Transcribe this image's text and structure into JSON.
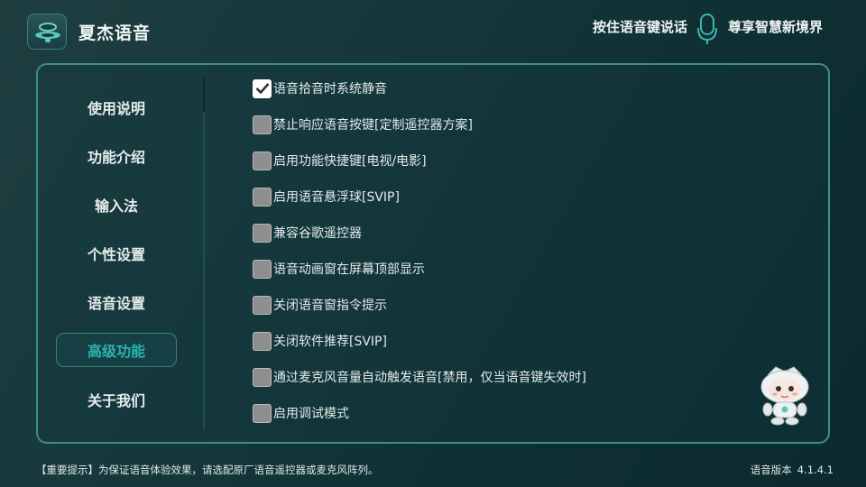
{
  "app": {
    "title": "夏杰语音",
    "logo_icon": "headset-logo-icon"
  },
  "header": {
    "hint": "按住语音键说话",
    "mic_icon": "microphone-icon",
    "slogan": "尊享智慧新境界"
  },
  "sidebar": {
    "items": [
      {
        "label": "使用说明",
        "active": false
      },
      {
        "label": "功能介绍",
        "active": false
      },
      {
        "label": "输入法",
        "active": false
      },
      {
        "label": "个性设置",
        "active": false
      },
      {
        "label": "语音设置",
        "active": false
      },
      {
        "label": "高级功能",
        "active": true
      },
      {
        "label": "关于我们",
        "active": false
      }
    ]
  },
  "options": [
    {
      "label": "语音拾音时系统静音",
      "checked": true
    },
    {
      "label": "禁止响应语音按键[定制遥控器方案]",
      "checked": false
    },
    {
      "label": "启用功能快捷键[电视/电影]",
      "checked": false
    },
    {
      "label": "启用语音悬浮球[SVIP]",
      "checked": false
    },
    {
      "label": "兼容谷歌遥控器",
      "checked": false
    },
    {
      "label": "语音动画窗在屏幕顶部显示",
      "checked": false
    },
    {
      "label": "关闭语音窗指令提示",
      "checked": false
    },
    {
      "label": "关闭软件推荐[SVIP]",
      "checked": false
    },
    {
      "label": "通过麦克风音量自动触发语音[禁用，仅当语音键失效时]",
      "checked": false
    },
    {
      "label": "启用调试模式",
      "checked": false
    }
  ],
  "mascot_icon": "robot-mascot-icon",
  "footer": {
    "notice": "【重要提示】为保证语音体验效果，请选配原厂语音遥控器或麦克风阵列。",
    "version_label": "语音版本",
    "version_value": "4.1.4.1"
  },
  "colors": {
    "accent": "#2ab3ad",
    "panel_border": "#3f8d8a"
  }
}
